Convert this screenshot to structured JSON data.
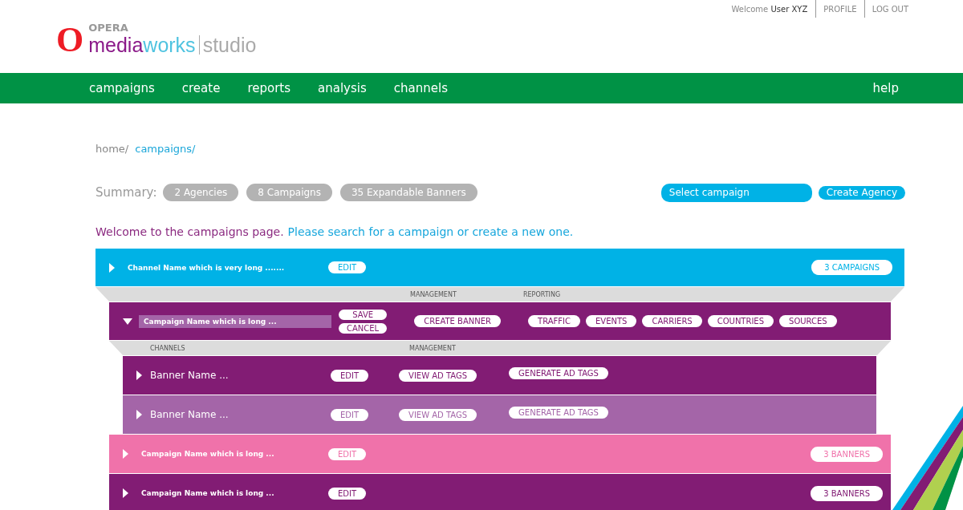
{
  "logo": {
    "mark": "O",
    "top": "OPERA",
    "part1": "media",
    "part2": "works",
    "part3": "studio"
  },
  "user_menu": {
    "greeting": "Welcome",
    "user": "User XYZ",
    "links": [
      "PROFILE",
      "LOG OUT"
    ]
  },
  "nav": {
    "items": [
      "campaigns",
      "create",
      "reports",
      "analysis",
      "channels"
    ],
    "help": "help"
  },
  "breadcrumb": [
    "home/",
    "campaigns/"
  ],
  "summary": {
    "label": "Summary:",
    "badges": [
      "2 Agencies",
      "8 Campaigns",
      "35 Expandable Banners"
    ]
  },
  "search": {
    "placeholder": "Select campaign"
  },
  "create_button": "Create Agency",
  "welcome": {
    "title": "Welcome to the campaigns page.",
    "hint": "Please search for a campaign or create a new one."
  },
  "channel": {
    "name": "Channel Name which is very long .......",
    "expanded": false,
    "edit": "EDIT",
    "count": "3 CAMPAIGNS",
    "header": [
      "MANAGEMENT",
      "REPORTING"
    ],
    "campaigns": [
      {
        "kind": "editing",
        "name": "Campaign Name which is long ...",
        "expanded": true,
        "color": "#821c74",
        "save": "SAVE",
        "cancel": "CANCEL",
        "management": [
          "CREATE BANNER"
        ],
        "reporting": [
          "TRAFFIC",
          "EVENTS",
          "CARRIERS",
          "COUNTRIES",
          "SOURCES"
        ],
        "header": [
          "CHANNELS",
          "MANAGEMENT"
        ],
        "banners": [
          {
            "name": "Banner Name ...",
            "expanded": false,
            "color": "#821c74",
            "edit": "EDIT",
            "view": "VIEW AD TAGS",
            "generate": "GENERATE AD TAGS"
          },
          {
            "name": "Banner Name ...",
            "expanded": false,
            "color": "#a465a8",
            "edit": "EDIT",
            "view": "VIEW AD TAGS",
            "generate": "GENERATE AD TAGS"
          }
        ]
      },
      {
        "kind": "collapsed",
        "name": "Campaign Name which is long ...",
        "expanded": false,
        "color": "#f072aa",
        "edit": "EDIT",
        "count": "3 BANNERS"
      },
      {
        "kind": "collapsed",
        "name": "Campaign Name which is long ...",
        "expanded": false,
        "color": "#821c74",
        "edit": "EDIT",
        "count": "3 BANNERS"
      }
    ]
  }
}
